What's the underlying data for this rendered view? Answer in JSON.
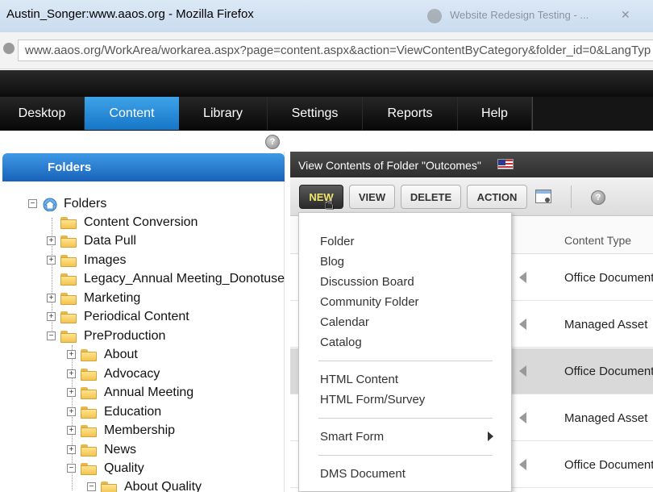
{
  "browser": {
    "window_title": "Austin_Songer:www.aaos.org - Mozilla Firefox",
    "background_tab": "Website Redesign Testing - ...",
    "url": "www.aaos.org/WorkArea/workarea.aspx?page=content.aspx&action=ViewContentByCategory&folder_id=0&LangTyp"
  },
  "topnav": {
    "tabs": [
      {
        "label": "Desktop",
        "active": false
      },
      {
        "label": "Content",
        "active": true
      },
      {
        "label": "Library",
        "active": false
      },
      {
        "label": "Settings",
        "active": false
      },
      {
        "label": "Reports",
        "active": false
      },
      {
        "label": "Help",
        "active": false
      }
    ]
  },
  "help_icon": "?",
  "folders_panel": {
    "header": "Folders",
    "root_label": "Folders",
    "items": [
      {
        "label": "Content Conversion"
      },
      {
        "label": "Data Pull"
      },
      {
        "label": "Images"
      },
      {
        "label": "Legacy_Annual Meeting_Donotuse"
      },
      {
        "label": "Marketing"
      },
      {
        "label": "Periodical Content"
      },
      {
        "label": "PreProduction"
      },
      {
        "label": "About"
      },
      {
        "label": "Advocacy"
      },
      {
        "label": "Annual Meeting"
      },
      {
        "label": "Education"
      },
      {
        "label": "Membership"
      },
      {
        "label": "News"
      },
      {
        "label": "Quality"
      },
      {
        "label": "About Quality"
      }
    ]
  },
  "content_view": {
    "title": "View Contents of Folder \"Outcomes\"",
    "toolbar": {
      "new_label": "NEW",
      "view_label": "VIEW",
      "delete_label": "DELETE",
      "action_label": "ACTION"
    },
    "column_header": "Content Type",
    "rows": [
      {
        "content_type": "Office Document"
      },
      {
        "content_type": "Managed Asset"
      },
      {
        "content_type": "Office Document"
      },
      {
        "content_type": "Managed Asset"
      },
      {
        "content_type": "Office Document"
      }
    ]
  },
  "new_menu": {
    "items_group1": [
      "Folder",
      "Blog",
      "Discussion Board",
      "Community Folder",
      "Calendar",
      "Catalog"
    ],
    "items_group2": [
      "HTML Content",
      "HTML Form/Survey"
    ],
    "items_group3": [
      "Smart Form"
    ],
    "items_group4": [
      "DMS Document"
    ]
  }
}
